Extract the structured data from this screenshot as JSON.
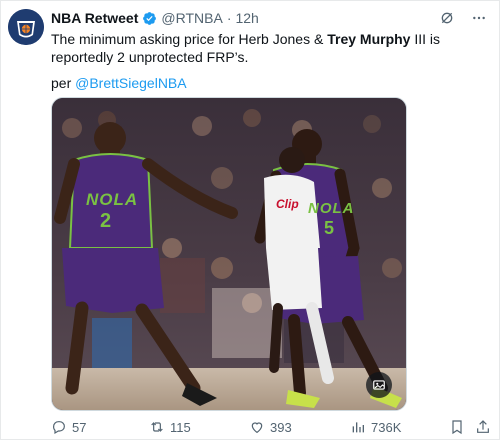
{
  "tweet": {
    "account_name": "NBA Retweet",
    "handle": "@RTNBA",
    "separator": "·",
    "time": "12h",
    "text_part1": "The minimum asking price for Herb Jones & ",
    "text_bold": "Trey Murphy",
    "text_part2": " III is reportedly 2 unprotected FRP’s.",
    "per_prefix": "per ",
    "mention": "@BrettSiegelNBA"
  },
  "photo": {
    "jersey_left_text": "NOLA",
    "jersey_left_number": "2",
    "jersey_right_text": "NOLA",
    "jersey_right_number": "5",
    "opponent_jersey_text": "Clip"
  },
  "actions": {
    "replies": "57",
    "retweets": "115",
    "likes": "393",
    "views": "736K"
  },
  "colors": {
    "accent": "#1d9bf0",
    "text": "#0f1419",
    "muted": "#536471",
    "pelicans_purple": "#4b2a7a",
    "pelicans_green": "#7ac143"
  },
  "icons": {
    "verified": "verified-badge-icon",
    "grok": "grok-icon",
    "more": "more-icon",
    "reply": "reply-icon",
    "retweet": "retweet-icon",
    "like": "heart-icon",
    "views": "views-icon",
    "bookmark": "bookmark-icon",
    "share": "share-icon",
    "media_overlay": "image-edit-icon"
  }
}
